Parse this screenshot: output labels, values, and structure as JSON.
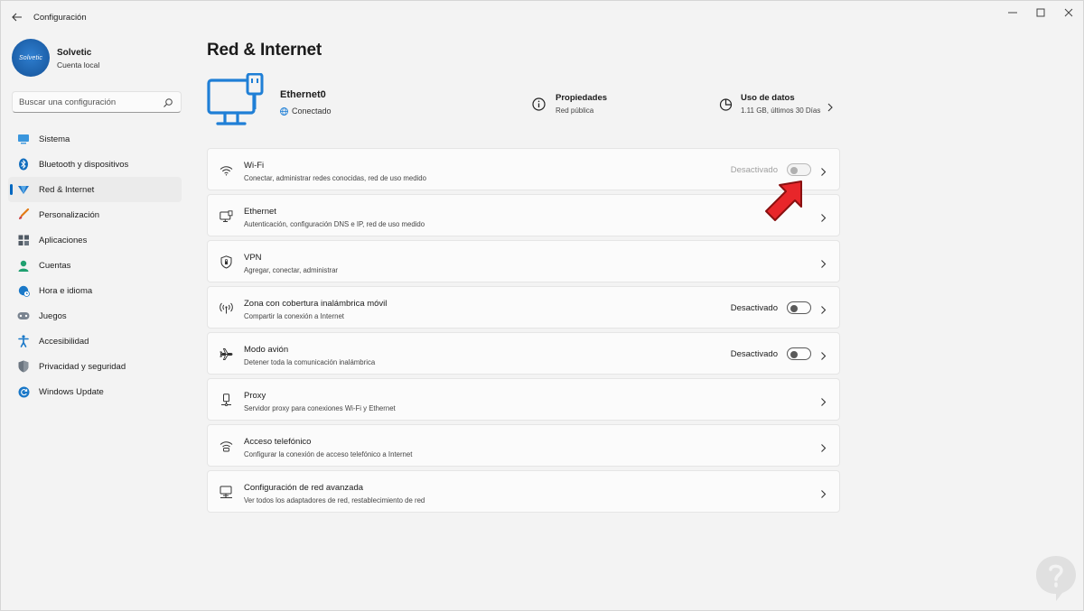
{
  "window": {
    "title": "Configuración",
    "back_icon": "back-arrow-icon",
    "controls": [
      "minimize-icon",
      "maximize-icon",
      "close-icon"
    ]
  },
  "profile": {
    "avatar_text": "Solvetic",
    "name": "Solvetic",
    "account_type": "Cuenta local"
  },
  "search": {
    "placeholder": "Buscar una configuración",
    "icon": "search-icon"
  },
  "sidebar": {
    "items": [
      {
        "label": "Sistema",
        "icon": "monitor-icon",
        "active": false
      },
      {
        "label": "Bluetooth y dispositivos",
        "icon": "bluetooth-icon",
        "active": false
      },
      {
        "label": "Red & Internet",
        "icon": "network-diamond-icon",
        "active": true
      },
      {
        "label": "Personalización",
        "icon": "brush-icon",
        "active": false
      },
      {
        "label": "Aplicaciones",
        "icon": "apps-grid-icon",
        "active": false
      },
      {
        "label": "Cuentas",
        "icon": "user-icon",
        "active": false
      },
      {
        "label": "Hora e idioma",
        "icon": "globe-clock-icon",
        "active": false
      },
      {
        "label": "Juegos",
        "icon": "gamepad-icon",
        "active": false
      },
      {
        "label": "Accesibilidad",
        "icon": "accessibility-icon",
        "active": false
      },
      {
        "label": "Privacidad y seguridad",
        "icon": "shield-icon",
        "active": false
      },
      {
        "label": "Windows Update",
        "icon": "refresh-icon",
        "active": false
      }
    ],
    "accent_color": "#0067c0"
  },
  "main": {
    "title": "Red & Internet",
    "connection": {
      "name": "Ethernet0",
      "status": "Conectado",
      "icon": "ethernet-computer-icon"
    },
    "properties": {
      "title": "Propiedades",
      "subtitle": "Red pública",
      "icon": "info-icon"
    },
    "data_usage": {
      "title": "Uso de datos",
      "subtitle": "1.11 GB, últimos 30 Días",
      "icon": "pie-chart-icon"
    },
    "cards": [
      {
        "title": "Wi-Fi",
        "subtitle": "Conectar, administrar redes conocidas, red de uso medido",
        "icon": "wifi-icon",
        "state": "Desactivado",
        "toggle": "off-disabled"
      },
      {
        "title": "Ethernet",
        "subtitle": "Autenticación, configuración DNS e IP, red de uso medido",
        "icon": "ethernet-icon"
      },
      {
        "title": "VPN",
        "subtitle": "Agregar, conectar, administrar",
        "icon": "vpn-shield-icon"
      },
      {
        "title": "Zona con cobertura inalámbrica móvil",
        "subtitle": "Compartir la conexión a Internet",
        "icon": "hotspot-icon",
        "state": "Desactivado",
        "toggle": "off"
      },
      {
        "title": "Modo avión",
        "subtitle": "Detener toda la comunicación inalámbrica",
        "icon": "airplane-icon",
        "state": "Desactivado",
        "toggle": "off"
      },
      {
        "title": "Proxy",
        "subtitle": "Servidor proxy para conexiones Wi-Fi y Ethernet",
        "icon": "proxy-icon"
      },
      {
        "title": "Acceso telefónico",
        "subtitle": "Configurar la conexión de acceso telefónico a Internet",
        "icon": "dialup-icon"
      },
      {
        "title": "Configuración de red avanzada",
        "subtitle": "Ver todos los adaptadores de red, restablecimiento de red",
        "icon": "network-adapter-icon"
      }
    ]
  },
  "annotation": {
    "icon": "red-pointer-arrow-icon",
    "color": "#e8262a"
  },
  "watermark": {
    "icon": "solvetic-watermark-icon"
  }
}
